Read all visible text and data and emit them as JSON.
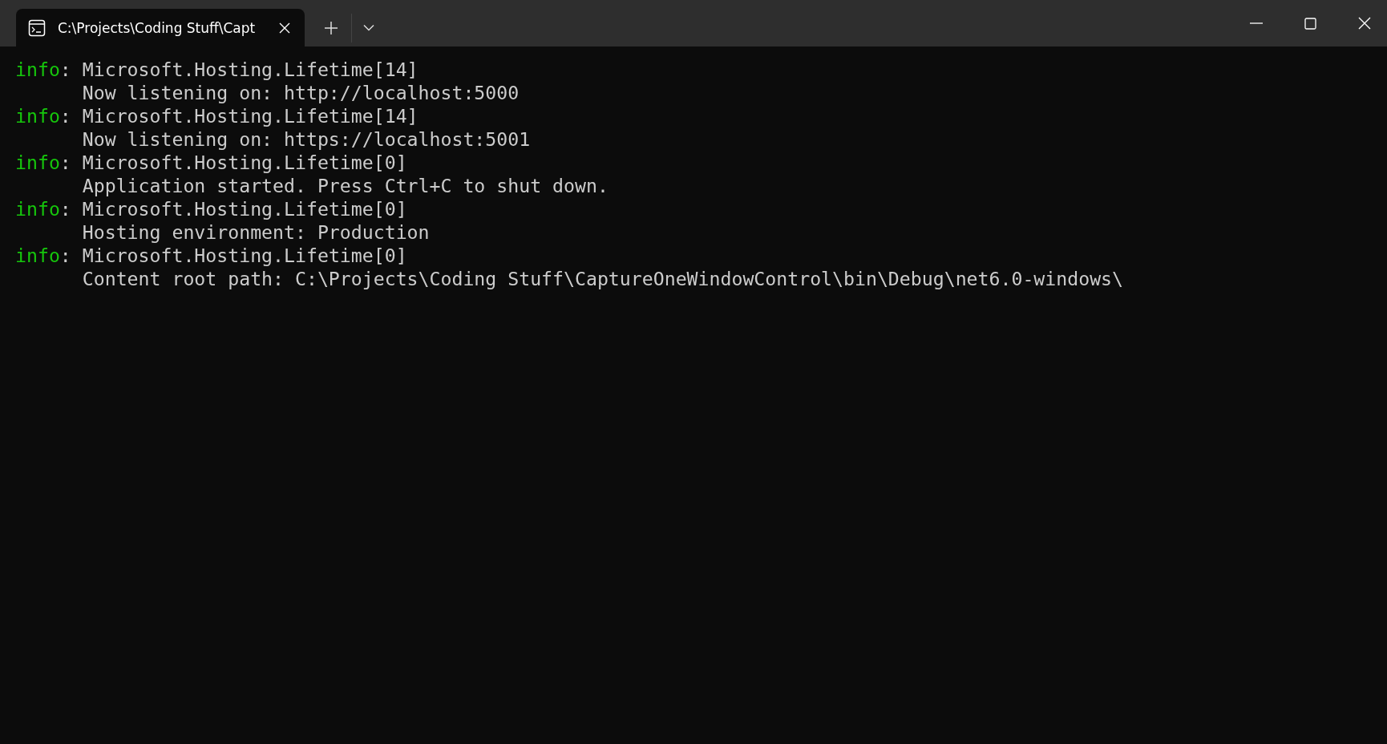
{
  "tabs": [
    {
      "title": "C:\\Projects\\Coding Stuff\\Capt",
      "selected": true
    }
  ],
  "log": [
    {
      "level": "info",
      "source": ": Microsoft.Hosting.Lifetime[14]",
      "message": "Now listening on: http://localhost:5000"
    },
    {
      "level": "info",
      "source": ": Microsoft.Hosting.Lifetime[14]",
      "message": "Now listening on: https://localhost:5001"
    },
    {
      "level": "info",
      "source": ": Microsoft.Hosting.Lifetime[0]",
      "message": "Application started. Press Ctrl+C to shut down."
    },
    {
      "level": "info",
      "source": ": Microsoft.Hosting.Lifetime[0]",
      "message": "Hosting environment: Production"
    },
    {
      "level": "info",
      "source": ": Microsoft.Hosting.Lifetime[0]",
      "message": "Content root path: C:\\Projects\\Coding Stuff\\CaptureOneWindowControl\\bin\\Debug\\net6.0-windows\\"
    }
  ]
}
